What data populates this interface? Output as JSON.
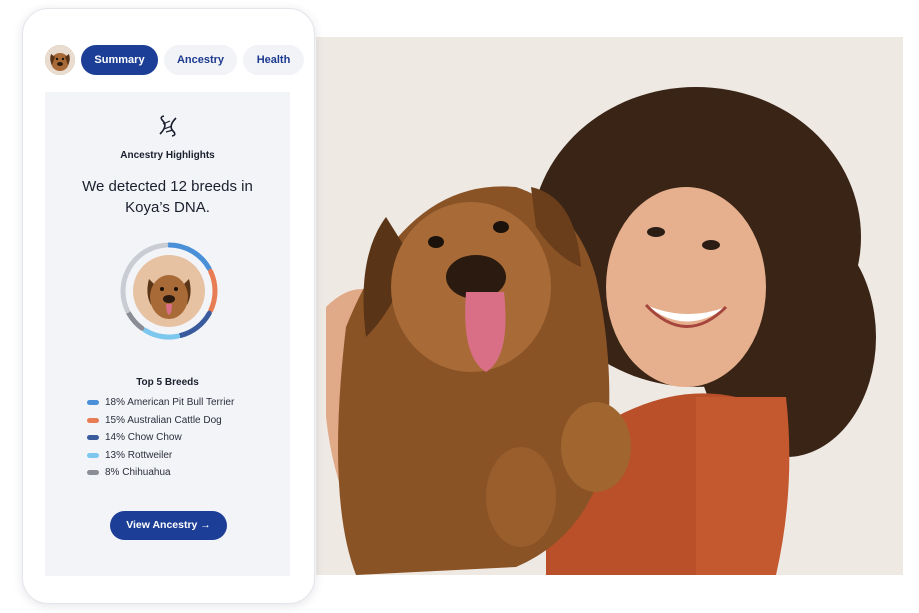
{
  "tabs": {
    "summary": "Summary",
    "ancestry": "Ancestry",
    "health": "Health"
  },
  "highlights": {
    "label": "Ancestry Highlights",
    "headline_line1": "We detected 12 breeds in",
    "headline_line2": "Koya’s DNA."
  },
  "top_breeds": {
    "label": "Top 5 Breeds",
    "items": [
      {
        "text": "18% American Pit Bull Terrier",
        "percent": 18,
        "color": "#4a90d9"
      },
      {
        "text": "15% Australian Cattle Dog",
        "percent": 15,
        "color": "#e87c55"
      },
      {
        "text": "14% Chow Chow",
        "percent": 14,
        "color": "#3a5a9e"
      },
      {
        "text": "13% Rottweiler",
        "percent": 13,
        "color": "#7cc7ee"
      },
      {
        "text": "8% Chihuahua",
        "percent": 8,
        "color": "#8a8d96"
      }
    ]
  },
  "cta": {
    "label": "View Ancestry →"
  },
  "icons": {
    "dna": "dna-icon",
    "avatar": "dog-avatar",
    "arrow": "arrow-right-icon"
  },
  "colors": {
    "brand": "#1c3e96",
    "panel": "#f3f4f7",
    "photo_bg": "#efe9e4"
  }
}
